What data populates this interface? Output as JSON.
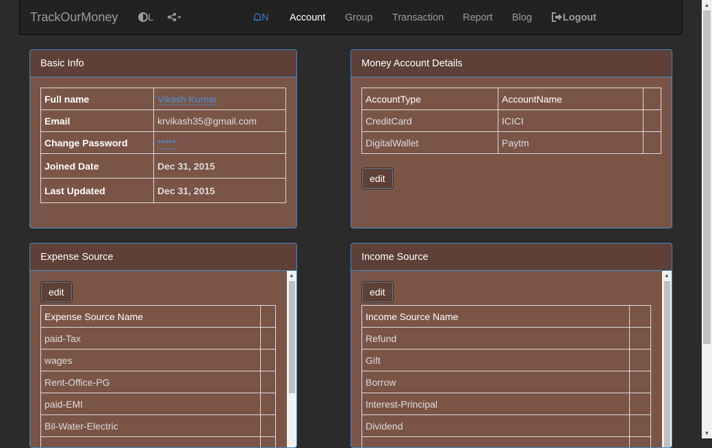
{
  "navbar": {
    "brand": "TrackOurMoney",
    "theme_label": "L",
    "notif_label": "N",
    "links": [
      "Account",
      "Group",
      "Transaction",
      "Report",
      "Blog"
    ],
    "active": "Account",
    "logout": "Logout"
  },
  "basic_info": {
    "title": "Basic Info",
    "rows": [
      {
        "label": "Full name",
        "value": "Vikash Kumar"
      },
      {
        "label": "Email",
        "value": "krvikash35@gmail.com"
      },
      {
        "label": "Change Password",
        "value": "*****"
      },
      {
        "label": "Joined Date",
        "value": "Dec 31, 2015"
      },
      {
        "label": "Last Updated",
        "value": "Dec 31, 2015"
      }
    ]
  },
  "money_accounts": {
    "title": "Money Account Details",
    "headers": [
      "AccountType",
      "AccountName"
    ],
    "rows": [
      {
        "type": "CreditCard",
        "name": "ICICI"
      },
      {
        "type": "DigitalWallet",
        "name": "Paytm"
      }
    ],
    "edit_label": "edit"
  },
  "expense_source": {
    "title": "Expense Source",
    "edit_label": "edit",
    "header": "Expense Source Name",
    "rows": [
      "paid-Tax",
      "wages",
      "Rent-Office-PG",
      "paid-EMI",
      "Bil-Water-Electric"
    ]
  },
  "income_source": {
    "title": "Income Source",
    "edit_label": "edit",
    "header": "Income Source Name",
    "rows": [
      "Refund",
      "Gift",
      "Borrow",
      "Interest-Principal",
      "Dividend"
    ]
  }
}
